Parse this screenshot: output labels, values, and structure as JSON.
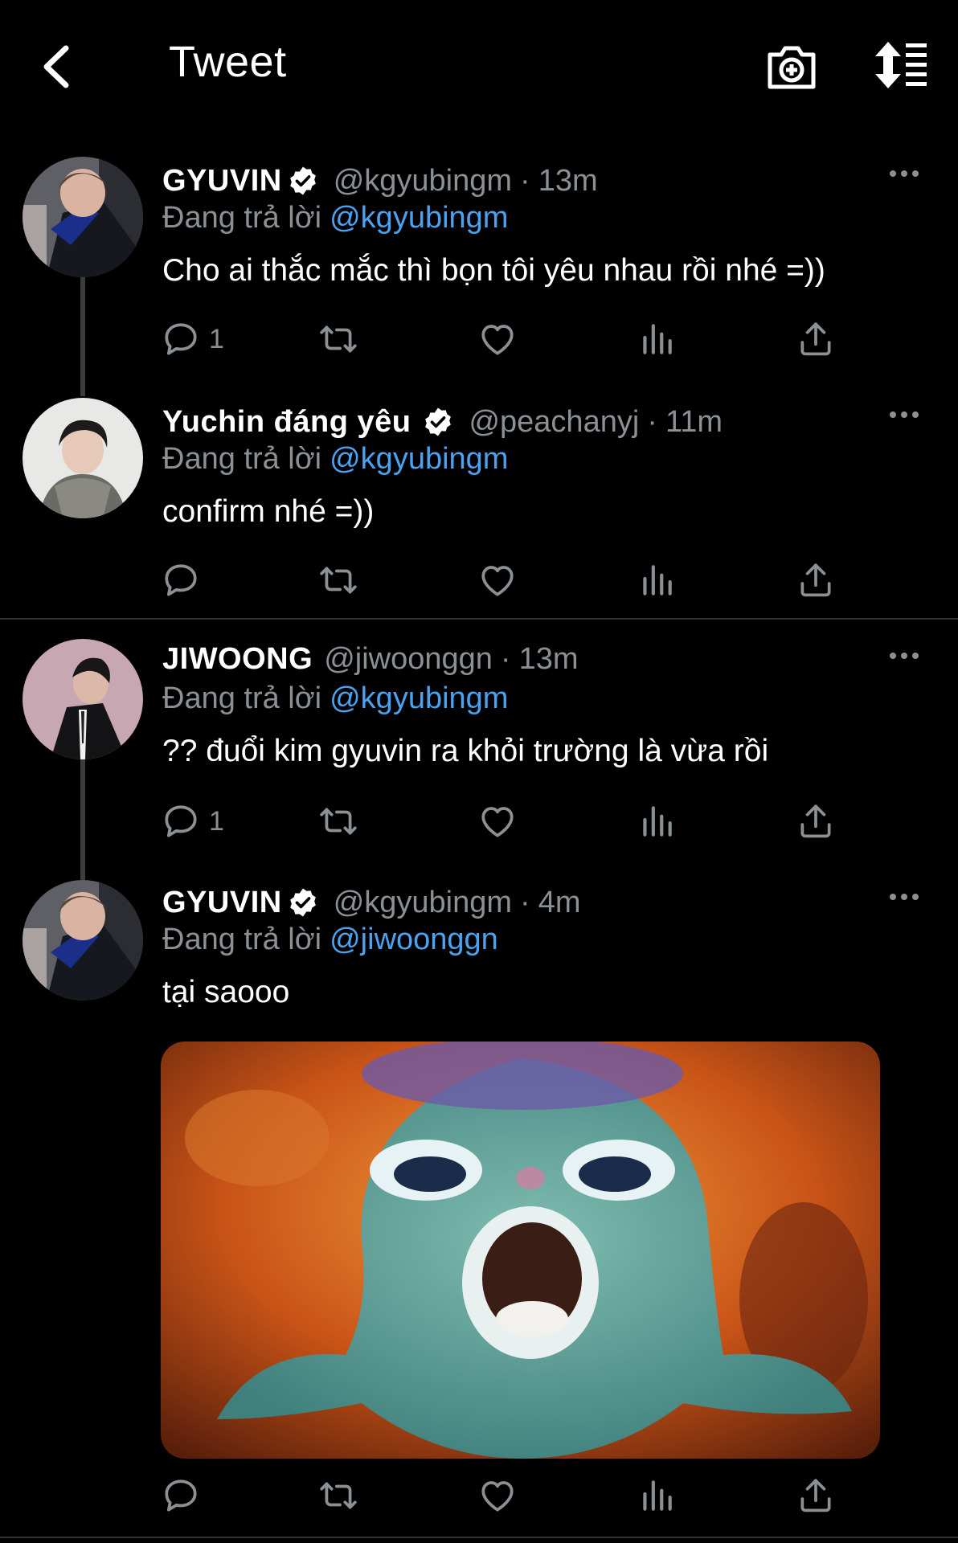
{
  "header": {
    "title": "Tweet",
    "icons": [
      "back-arrow-icon",
      "camera-plus-icon",
      "sort-thread-icon"
    ]
  },
  "colors": {
    "background": "#000000",
    "text": "#e7e9ea",
    "secondary": "#8b9095",
    "mention": "#4aa2f0",
    "verified": "#ffffff"
  },
  "tweets": [
    {
      "name": "GYUVIN",
      "verified": true,
      "handle": "@kgyubingm",
      "dot": "·",
      "time": "13m",
      "reply_prefix": "Đang trả lời",
      "reply_to": "@kgyubingm",
      "text": "Cho ai thắc mắc thì bọn tôi yêu nhau rồi nhé =))",
      "reply_count": "1"
    },
    {
      "name": "Yuchin đáng yêu",
      "verified": true,
      "handle": "@peachanyj",
      "dot": "·",
      "time": "11m",
      "reply_prefix": "Đang trả lời",
      "reply_to": "@kgyubingm",
      "text": "confirm nhé =))",
      "reply_count": ""
    },
    {
      "name": "JIWOONG",
      "verified": false,
      "handle": "@jiwoonggn",
      "dot": "·",
      "time": "13m",
      "reply_prefix": "Đang trả lời",
      "reply_to": "@kgyubingm",
      "text": "?? đuổi kim gyuvin ra khỏi trường là vừa rồi",
      "reply_count": "1"
    },
    {
      "name": "GYUVIN",
      "verified": true,
      "handle": "@kgyubingm",
      "dot": "·",
      "time": "4m",
      "reply_prefix": "Đang trả lời",
      "reply_to": "@jiwoonggn",
      "text": "tại saooo",
      "reply_count": "",
      "media": "photo"
    }
  ]
}
